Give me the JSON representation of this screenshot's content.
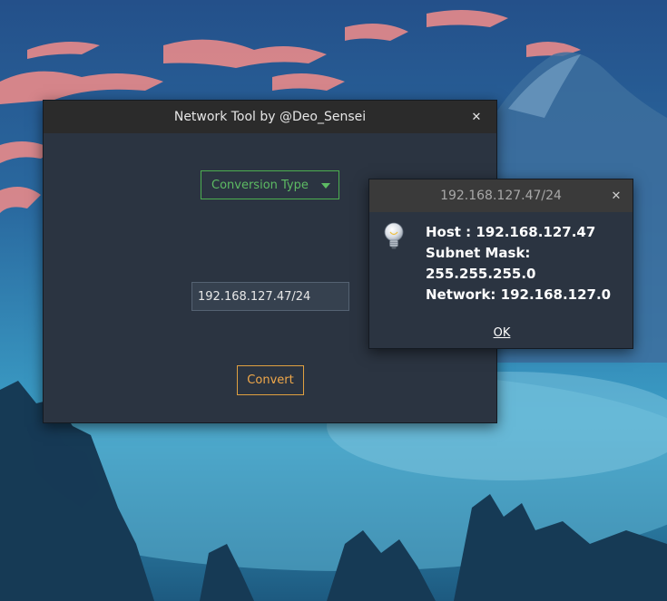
{
  "main_window": {
    "title": "Network Tool by @Deo_Sensei",
    "close_glyph": "✕",
    "dropdown": {
      "selected": "Conversion Type"
    },
    "ip_input": {
      "value": "192.168.127.47/24"
    },
    "convert_label": "Convert"
  },
  "dialog": {
    "title": "192.168.127.47/24",
    "close_glyph": "✕",
    "icon": "lightbulb-icon",
    "lines": {
      "host": "Host : 192.168.127.47",
      "subnet": "Subnet Mask: 255.255.255.0",
      "network": "Network: 192.168.127.0"
    },
    "ok_label": "OK"
  },
  "colors": {
    "accent_green": "#5dbb63",
    "accent_orange": "#f0a84a",
    "window_bg": "#2b3441",
    "titlebar_bg": "#2b2b2b"
  }
}
